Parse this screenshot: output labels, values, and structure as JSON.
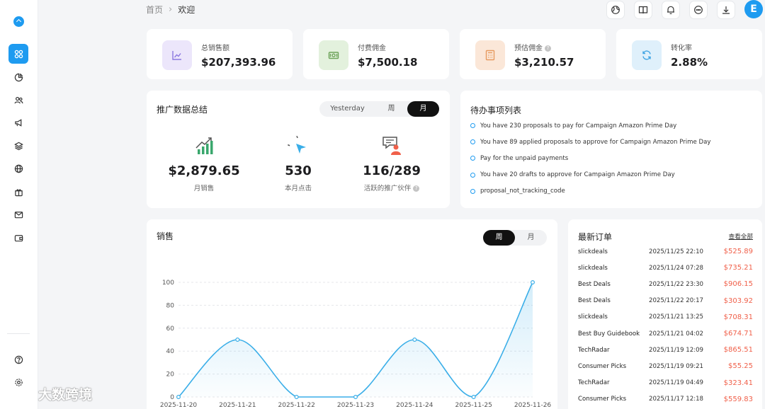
{
  "breadcrumb": {
    "home": "首页",
    "current": "欢迎"
  },
  "user": {
    "avatar_letter": "E"
  },
  "stats": [
    {
      "label": "总销售额",
      "value": "$207,393.96",
      "icon": "line-chart-icon",
      "bg": "#ece6fb",
      "color": "#8c78e0"
    },
    {
      "label": "付费佣金",
      "value": "$7,500.18",
      "icon": "cash-icon",
      "bg": "#e3f1dd",
      "color": "#6da35a"
    },
    {
      "label": "预估佣金",
      "value": "$3,210.57",
      "icon": "calculator-icon",
      "bg": "#fbe7d8",
      "color": "#e79a5f",
      "info": "?"
    },
    {
      "label": "转化率",
      "value": "2.88%",
      "icon": "refresh-icon",
      "bg": "#dff0fb",
      "color": "#3ea3e3"
    }
  ],
  "promo": {
    "title": "推广数据总结",
    "tabs": [
      "Yesterday",
      "周",
      "月"
    ],
    "active_tab": "月",
    "metrics": [
      {
        "value": "$2,879.65",
        "label": "月销售",
        "icon": "growth-chart-icon"
      },
      {
        "value": "530",
        "label": "本月点击",
        "icon": "cursor-click-icon"
      },
      {
        "value": "116/289",
        "label": "活跃的推广伙伴",
        "icon": "partner-icon",
        "info": "?"
      }
    ]
  },
  "todo": {
    "title": "待办事项列表",
    "items": [
      "You have 230 proposals to pay for Campaign Amazon Prime Day",
      "You have 89 applied proposals to approve for Campaign Amazon Prime Day",
      "Pay for the unpaid payments",
      "You have 20 drafts to approve for Campaign Amazon Prime Day",
      "proposal_not_tracking_code"
    ]
  },
  "sales": {
    "title": "销售",
    "tabs": [
      "周",
      "月"
    ],
    "active_tab": "周"
  },
  "chart_data": {
    "type": "area",
    "x": [
      "2025-11-20",
      "2025-11-21",
      "2025-11-22",
      "2025-11-23",
      "2025-11-24",
      "2025-11-25",
      "2025-11-26"
    ],
    "series": [
      {
        "values": [
          0,
          50,
          0,
          0,
          50,
          0,
          100
        ]
      }
    ],
    "yticks": [
      0,
      20,
      40,
      60,
      80,
      100
    ],
    "ylim": [
      0,
      100
    ],
    "grid": "horizontal-dashed",
    "color": "#3aaee8"
  },
  "orders": {
    "title": "最新订单",
    "view_all": "查看全部",
    "rows": [
      {
        "source": "slickdeals",
        "time": "2025/11/25 22:10",
        "amount": "$525.89"
      },
      {
        "source": "slickdeals",
        "time": "2025/11/24 07:28",
        "amount": "$735.21"
      },
      {
        "source": "Best Deals",
        "time": "2025/11/22 23:30",
        "amount": "$906.15"
      },
      {
        "source": "Best Deals",
        "time": "2025/11/22 20:17",
        "amount": "$303.92"
      },
      {
        "source": "slickdeals",
        "time": "2025/11/21 13:25",
        "amount": "$708.31"
      },
      {
        "source": "Best Buy Guidebook",
        "time": "2025/11/21 04:02",
        "amount": "$674.71"
      },
      {
        "source": "TechRadar",
        "time": "2025/11/19 12:09",
        "amount": "$865.51"
      },
      {
        "source": "Consumer Picks",
        "time": "2025/11/19 09:21",
        "amount": "$55.25"
      },
      {
        "source": "TechRadar",
        "time": "2025/11/19 04:49",
        "amount": "$323.41"
      },
      {
        "source": "Consumer Picks",
        "time": "2025/11/17 12:18",
        "amount": "$559.83"
      }
    ]
  },
  "watermark": {
    "text": "大数跨境"
  }
}
